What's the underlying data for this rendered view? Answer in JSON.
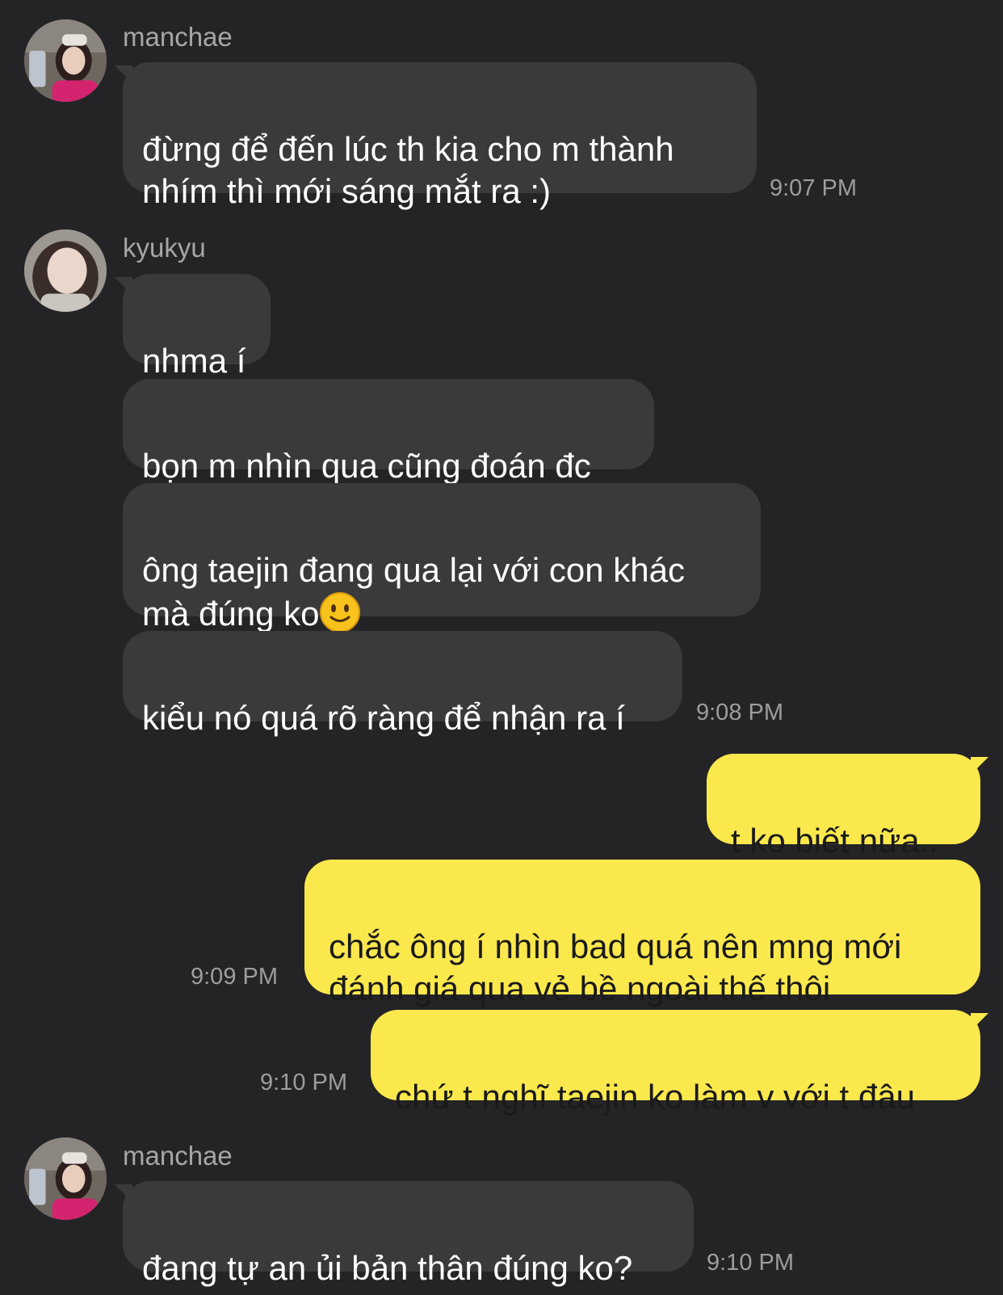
{
  "messages": [
    {
      "sender": "manchae",
      "text": "đừng để đến lúc th kia cho m thành\nnhím thì mới sáng mắt ra :)",
      "time": "9:07 PM"
    },
    {
      "sender": "kyukyu",
      "text": "nhma í"
    },
    {
      "text": "bọn m nhìn qua cũng đoán đc"
    },
    {
      "text": "ông taejin đang qua lại với con khác\nmà đúng ko",
      "emoji_icon": "slightly-smiling-face-icon"
    },
    {
      "text": "kiểu nó quá rõ ràng để nhận ra í",
      "time": "9:08 PM"
    },
    {
      "direction": "out",
      "text": "t ko biết nữa.."
    },
    {
      "direction": "out",
      "text": "chắc ông í nhìn bad quá nên mng mới\nđánh giá qua vẻ bề ngoài thế thôi",
      "time": "9:09 PM"
    },
    {
      "direction": "out",
      "text": "chứ t nghĩ taejin ko làm v với t đâu",
      "time": "9:10 PM"
    },
    {
      "sender": "manchae",
      "text": "đang tự an ủi bản thân đúng ko?",
      "time": "9:10 PM"
    }
  ],
  "colors": {
    "background": "#242426",
    "incoming_bubble": "#3a3a3c",
    "outgoing_bubble": "#fbe84d",
    "sender_name": "#a6a6a8",
    "timestamp": "#9d9da0"
  }
}
